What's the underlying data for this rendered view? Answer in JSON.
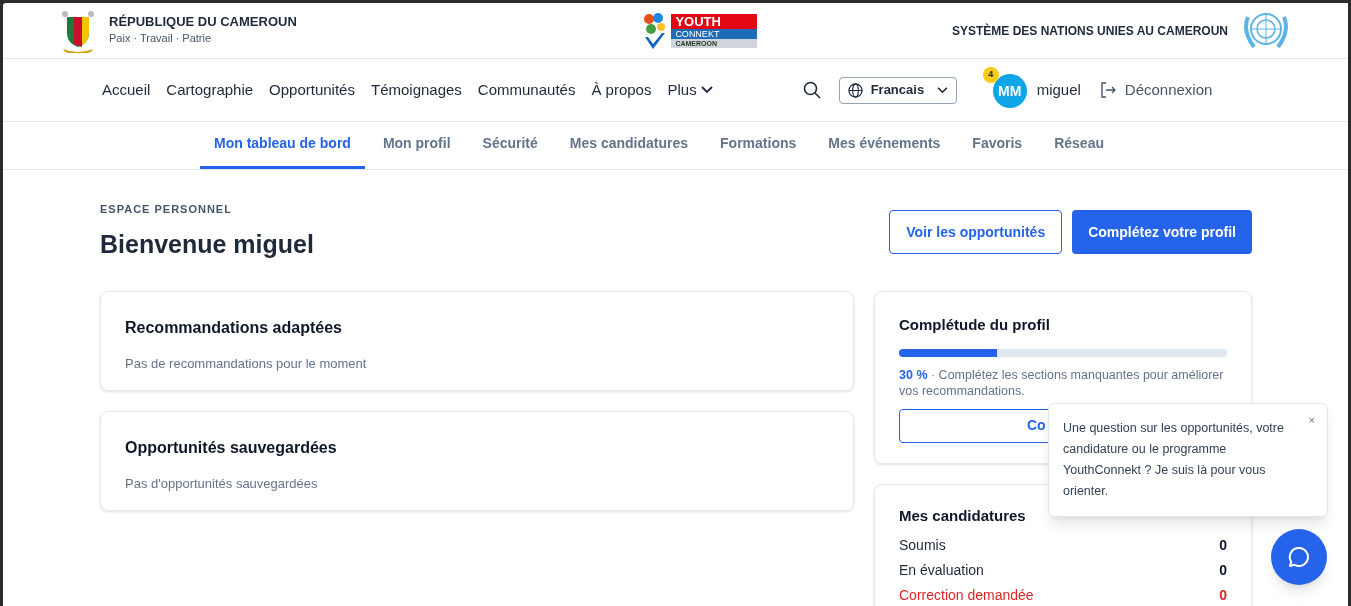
{
  "header": {
    "country": "RÉPUBLIQUE DU CAMEROUN",
    "motto": "Paix · Travail · Patrie",
    "logo_words": [
      "YOUTH",
      "CONNEKT",
      "CAMEROON"
    ],
    "partner": "SYSTÈME DES NATIONS UNIES AU CAMEROUN"
  },
  "nav": {
    "items": [
      "Accueil",
      "Cartographie",
      "Opportunités",
      "Témoignages",
      "Communautés",
      "À propos"
    ],
    "more": "Plus",
    "language": "Francais",
    "notifications": "4",
    "avatar": "MM",
    "user": "miguel",
    "logout": "Déconnexion"
  },
  "tabs": [
    {
      "label": "Mon tableau de bord",
      "selected": true
    },
    {
      "label": "Mon profil",
      "selected": false
    },
    {
      "label": "Sécurité",
      "selected": false
    },
    {
      "label": "Mes candidatures",
      "selected": false
    },
    {
      "label": "Formations",
      "selected": false
    },
    {
      "label": "Mes événements",
      "selected": false
    },
    {
      "label": "Favoris",
      "selected": false
    },
    {
      "label": "Réseau",
      "selected": false
    }
  ],
  "page": {
    "eyebrow": "ESPACE PERSONNEL",
    "title": "Bienvenue miguel",
    "buttons": [
      {
        "label": "Voir les opportunités",
        "kind": "outline"
      },
      {
        "label": "Complétez votre profil",
        "kind": "primary"
      }
    ]
  },
  "cards": [
    {
      "title": "Recommandations adaptées",
      "text": "Pas de recommandations pour le moment"
    },
    {
      "title": "Opportunités sauvegardées",
      "text": "Pas d'opportunités sauvegardées"
    }
  ],
  "profile": {
    "title": "Complétude du profil",
    "level": 0.3,
    "percent": "30 %",
    "text": " · Complétez les sections manquantes pour améliorer vos recommandations.",
    "button": "Co"
  },
  "applications": {
    "title": "Mes candidatures",
    "rows": [
      {
        "label": "Soumis",
        "count": "0",
        "kind": "normal"
      },
      {
        "label": "En évaluation",
        "count": "0",
        "kind": "normal"
      },
      {
        "label": "Correction demandée",
        "count": "0",
        "kind": "alert"
      }
    ]
  },
  "chat": {
    "message": "Une question sur les opportunités, votre candidature ou le programme YouthConnekt ? Je suis là pour vous orienter.",
    "close": "×"
  }
}
